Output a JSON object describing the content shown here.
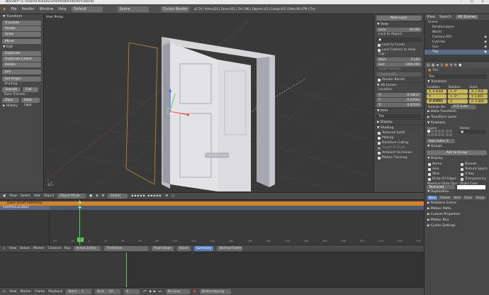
{
  "window": {
    "title": "Blender* [C:\\Users\\Felix\\Documents\\Blender\\tire.blend]",
    "controls": "– □ ×"
  },
  "menu": {
    "items": [
      "File",
      "Render",
      "Window",
      "Help"
    ],
    "layout": "Default",
    "scene": "Scene",
    "engine": "Cycles Render",
    "stats": "v2.76 | Verts:424 | Faces:431 | Tris:796 | Objects:1/3 | Lamps:0/1 | Mem:80.47M | Tire"
  },
  "toolshelf": {
    "transform_hdr": "▼ Transform",
    "translate": "Translate",
    "rotate": "Rotate",
    "scale": "Scale",
    "mirror": "Mirror",
    "edit_hdr": "▼ Edit",
    "duplicate": "Duplicate",
    "duplicate_linked": "Duplicate Linked",
    "delete": "Delete",
    "join": "Join",
    "set_origin": "Set Origin",
    "shading_lbl": "Shading:",
    "smooth": "Smooth",
    "flat": "Flat",
    "data_transfer_lbl": "Data Transfer:",
    "data": "Data",
    "data_layo": "Data Layo",
    "history_hdr": "▶ History"
  },
  "viewport": {
    "label": "User Persp"
  },
  "npanel": {
    "new_layer": "New Layer",
    "view_hdr": "▼ View",
    "lens_lbl": "Lens:",
    "lens_val": "35.000",
    "lock_lbl": "Lock to Object:",
    "lock_cursor": "Lock to Cursor",
    "lock_camera": "Lock Camera to View",
    "clip_lbl": "Clip:",
    "start_lbl": "Start:",
    "start_val": "0.100",
    "end_lbl": "End:",
    "end_val": "1000.000",
    "local_camera": "Local Camera:",
    "camera_field": "Camera.001",
    "render_border": "Render Border",
    "cursor_hdr": "▼ 3D Cursor",
    "location_lbl": "Location:",
    "x_lbl": "X:",
    "x_val": "-0.58437",
    "y_lbl": "Y:",
    "y_val": "-0.03503",
    "z_lbl": "Z:",
    "z_val": "0.00329",
    "item_hdr": "▼ Item",
    "item_name": "Tire",
    "display_hdr": "▶ Display",
    "shading_hdr": "▼ Shading",
    "textured_solid": "Textured Solid",
    "matcap": "Matcap",
    "backface": "Backface Culling",
    "depth_field": "Depth Of Field",
    "ambient": "Ambient Occlusion",
    "motion": "Motion Tracking"
  },
  "outliner": {
    "tabs": [
      "View",
      "Search",
      "All Scenes"
    ],
    "items": [
      "Scene",
      "RenderLayers",
      "World",
      "Camera.001",
      "Cylinder",
      "Sun",
      "Tire"
    ]
  },
  "props": {
    "object_name": "Tire",
    "transform_hdr": "▼ Transform",
    "location_lbl": "Location:",
    "rotation_lbl": "Rotation:",
    "scale_lbl": "Scale:",
    "loc": [
      "X: 0.0000",
      "Y: -0.00000",
      "Z: 0.0000"
    ],
    "rot": [
      "X: 0°",
      "Y: -0°",
      "Z: -24.648°"
    ],
    "scl": [
      "X: 1.000",
      "Y: 1.000",
      "Z: 1.000"
    ],
    "rot_mode_lbl": "Rotation Mo:",
    "rot_mode": "XYZ Euler",
    "delta_hdr": "▶ Delta Transform",
    "locks_hdr": "▶ Transform Locks",
    "relations_hdr": "▼ Relations",
    "layers_lbl": "Layers:",
    "parent_lbl": "Parent:",
    "pass_index": "Pass Index: 0",
    "groups_hdr": "▼ Groups",
    "add_group": "Add to Group",
    "display_hdr": "▼ Display",
    "name": "Name",
    "axis": "Axis",
    "wire": "Wire",
    "draw_edges": "Draw All Edges",
    "bounds": "Bounds",
    "texture_space": "Texture Space",
    "xray": "X-Ray",
    "transparency": "Transparency",
    "max_draw_lbl": "Maximum Draw Type:",
    "object_color_lbl": "Object Color:",
    "max_draw": "Textured",
    "duplication_hdr": "▼ Duplication",
    "dup_tabs": [
      "None",
      "Frames",
      "Verts",
      "Faces",
      "Group"
    ],
    "relations_extras": "▶ Relations Extras",
    "motion_paths": "▶ Motion Paths",
    "custom_props": "▶ Custom Properties",
    "motion_blur": "▶ Motion Blur",
    "cycles_settings": "▶ Cycles Settings"
  },
  "vheader": {
    "items": [
      "View",
      "Select",
      "Add",
      "Object"
    ],
    "mode": "Object Mode",
    "pivot": "Global"
  },
  "dopesheet": {
    "summary": "Dope Sheet Summary",
    "object": "LowPolyLocation",
    "ticks": [
      "-40",
      "-20",
      "0",
      "20",
      "40",
      "60",
      "80",
      "100",
      "120",
      "140",
      "160",
      "180",
      "200",
      "220",
      "240",
      "260",
      "280",
      "300",
      "320",
      "340",
      "350"
    ],
    "frame": "0"
  },
  "action_header": {
    "items": [
      "View",
      "Select",
      "Marker",
      "Channel",
      "Key"
    ],
    "mode": "Action Editor",
    "action": "TireAction",
    "push_down": "Push Down",
    "stash": "Stash",
    "summary": "Summary",
    "normal_frame": "Normal Frame"
  },
  "timeline": {
    "items": [
      "View",
      "Marker",
      "Frame",
      "Playback"
    ],
    "start": "Start:",
    "start_val": "1",
    "end": "End:",
    "end_val": "50",
    "frame_val": "0",
    "sync": "No Sync",
    "keying": "Button Keying"
  }
}
